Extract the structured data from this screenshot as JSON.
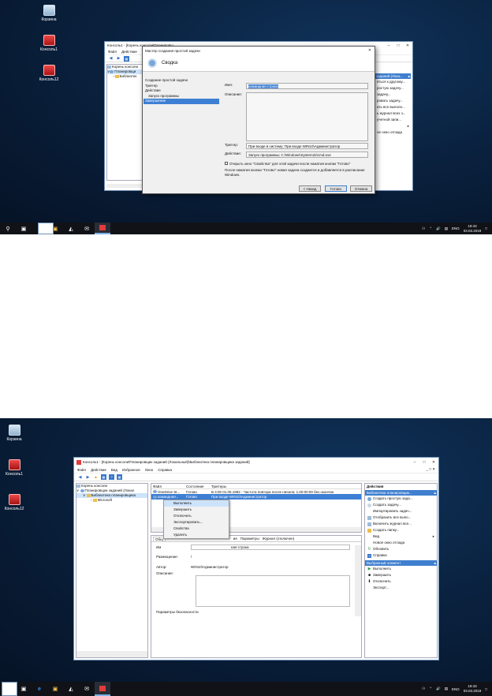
{
  "desktop": {
    "icons": [
      "Корзина",
      "Консоль1",
      "Консоль12"
    ]
  },
  "taskbar": {
    "tray_lang": "ENG",
    "time_1": "19:43",
    "date_1": "03.03.2019",
    "time_2": "19:43",
    "date_2": "03.03.2019"
  },
  "shot1": {
    "console_title": "Консоль1 - [Корень консоли\\Планировщ",
    "menu": [
      "Файл",
      "Действие"
    ],
    "tree": [
      "Корень консоли",
      "Планировщи",
      "Библиотек"
    ],
    "actions": [
      "заданий (Лока...",
      "яться к другому...",
      "ростую задачу...",
      "задачу...",
      "ровать задачу...",
      "ать все выполн...",
      "ь журнал всех з...",
      "учетной запи...",
      "",
      "",
      "ое окно отсюда"
    ],
    "wizard": {
      "title": "Мастер создания простой задачи",
      "header": "Сводка",
      "steps": [
        "Создание простой задачи",
        "Триггер",
        "Действие",
        "Запуск программы",
        "Завершение"
      ],
      "name_label": "Имя:",
      "name_value": "командная строка",
      "desc_label": "Описание:",
      "trigger_label": "Триггер:",
      "trigger_value": "При входе в систему; При входе WIN10\\Администратор",
      "action_label": "Действие:",
      "action_value": "Запуск программы; C:\\Windows\\System32\\cmd.exe",
      "checkbox_label": "Открыть окно \"Свойства\" для этой задачи после нажатия кнопки \"Готово\"",
      "note": "После нажатия кнопки \"Готово\" новая задача создается и добавляется в расписание Windows.",
      "back": "< Назад",
      "finish": "Готово",
      "cancel": "Отмена"
    }
  },
  "shot2": {
    "window_title": "Консоль1 - [Корень консоли\\Планировщик заданий (Локальный)\\Библиотека планировщика заданий]",
    "menu": [
      "Файл",
      "Действие",
      "Вид",
      "Избранное",
      "Окно",
      "Справка"
    ],
    "tree": [
      "Корень консоли",
      "Планировщик заданий (Локал",
      "Библиотека планировщика",
      "Microsoft"
    ],
    "columns": [
      "Файл",
      "Состояние",
      "Триггеры"
    ],
    "rows": [
      [
        "OneDrive St...",
        "Готово",
        "В 4:00 01.05.1992 - Частота повтора после начала: 1.00:00:00 без окончан"
      ],
      [
        "командная...",
        "Готово",
        "При входе WIN10\\Администратор"
      ]
    ],
    "context_menu": [
      "Выполнить",
      "Завершить",
      "Отключить",
      "Экспортировать...",
      "Свойства",
      "Удалить"
    ],
    "tabs": [
      "Общ",
      "ия",
      "Параметры",
      "Журнал (отключен)"
    ],
    "props": {
      "name_label": "Им",
      "name_value": "ная строка",
      "location_label": "Размещение:",
      "location_value": "\\",
      "author_label": "Автор:",
      "author_value": "WIN10\\Администратор",
      "desc_label": "Описание:",
      "security_label": "Параметры безопасности"
    },
    "actions": {
      "header": "Действия",
      "group1": "Библиотека планировщик...",
      "items1": [
        "Создать простую зада...",
        "Создать задачу...",
        "Импортировать задач...",
        "Отобразить все выпо...",
        "Включить журнал все...",
        "Создать папку...",
        "Вид",
        "Новое окно отсюда",
        "Обновить",
        "Справка"
      ],
      "group2": "Выбранный элемент",
      "items2": [
        "Выполнить",
        "Завершить",
        "Отключить",
        "Экспорт..."
      ]
    }
  }
}
